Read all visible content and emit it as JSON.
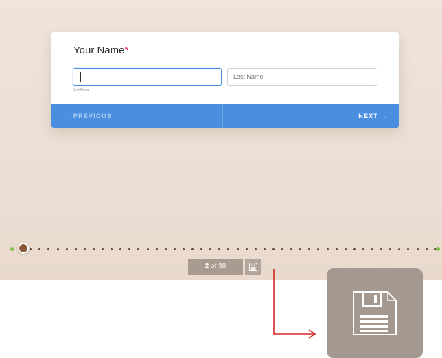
{
  "question": {
    "label": "Your Name",
    "required_mark": "*"
  },
  "fields": {
    "first": {
      "value": "",
      "sublabel": "First Name"
    },
    "last": {
      "placeholder": "Last Name"
    }
  },
  "nav": {
    "previous": "← PREVIOUS",
    "next": "NEXT →"
  },
  "progress": {
    "current": "2",
    "of_text": "of 38",
    "current_page": 2,
    "total_pages": 38
  },
  "colors": {
    "accent": "#4a8fdf",
    "required": "#e0245e",
    "progress_endpoint": "#7fc24b",
    "arrow": "#d62828"
  },
  "icons": {
    "save": "floppy-disk-icon"
  }
}
